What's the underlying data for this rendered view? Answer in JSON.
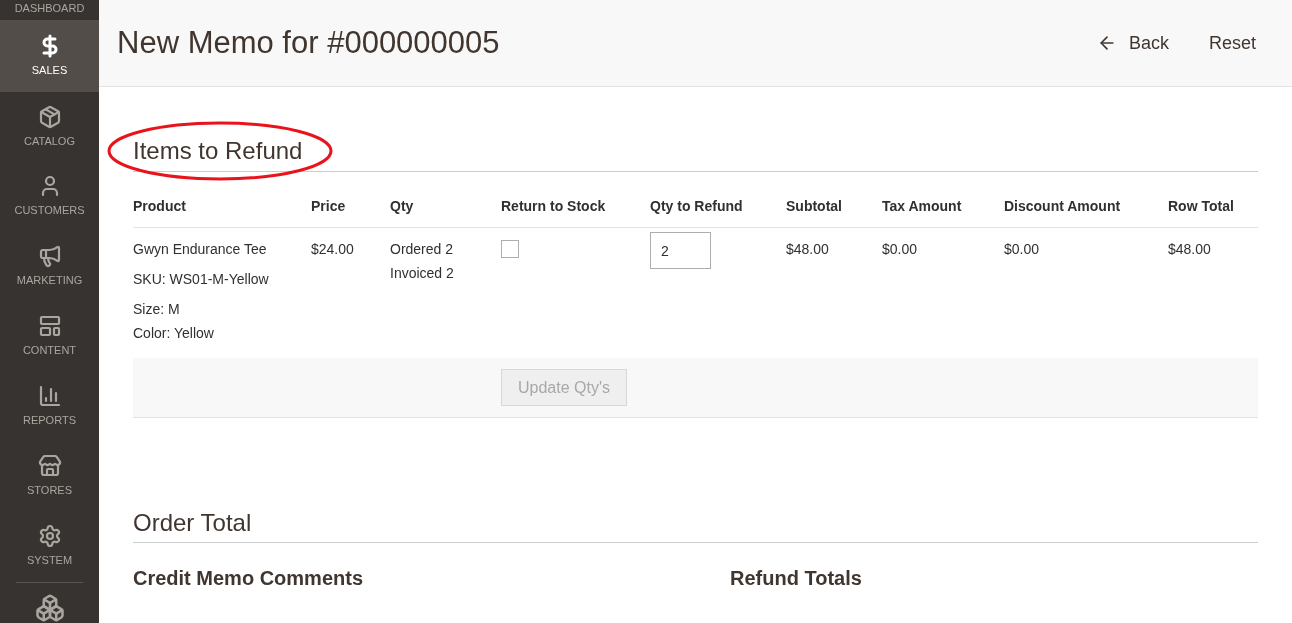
{
  "sidebar": {
    "items": [
      {
        "kind": "cut",
        "label": "DASHBOARD",
        "selected": false
      },
      {
        "kind": "dollar",
        "label": "SALES",
        "selected": true
      },
      {
        "kind": "box",
        "label": "CATALOG",
        "selected": false
      },
      {
        "kind": "person",
        "label": "CUSTOMERS",
        "selected": false
      },
      {
        "kind": "megaphone",
        "label": "MARKETING",
        "selected": false
      },
      {
        "kind": "layout",
        "label": "CONTENT",
        "selected": false
      },
      {
        "kind": "bars",
        "label": "REPORTS",
        "selected": false
      },
      {
        "kind": "store",
        "label": "STORES",
        "selected": false
      },
      {
        "kind": "gear",
        "label": "SYSTEM",
        "selected": false
      },
      {
        "kind": "brick"
      }
    ]
  },
  "header": {
    "title": "New Memo for #000000005",
    "actions": [
      {
        "kind": "back",
        "label": "Back"
      },
      {
        "kind": "plain",
        "label": "Reset"
      }
    ]
  },
  "items_section": {
    "title": "Items to Refund",
    "annotated": true,
    "table": {
      "columns": [
        "Product",
        "Price",
        "Qty",
        "Return to Stock",
        "Qty to Refund",
        "Subtotal",
        "Tax Amount",
        "Discount Amount",
        "Row Total"
      ],
      "rows": [
        {
          "product": "Gwyn Endurance Tee",
          "sku": "SKU: WS01-M-Yellow",
          "options": [
            {
              "label": "Size:",
              "value": "M"
            },
            {
              "label": "Color:",
              "value": "Yellow"
            }
          ],
          "price": "$24.00",
          "qty": [
            {
              "label": "Ordered",
              "value": "2"
            },
            {
              "label": "Invoiced",
              "value": "2"
            }
          ],
          "return_to_stock": false,
          "qty_to_refund": "2",
          "subtotal": "$48.00",
          "tax_amount": "$0.00",
          "discount_amount": "$0.00",
          "row_total": "$48.00"
        }
      ]
    },
    "update_button": {
      "label": "Update Qty's",
      "disabled": true
    }
  },
  "order_total": {
    "title": "Order Total",
    "columns": [
      "Credit Memo Comments",
      "Refund Totals"
    ]
  }
}
